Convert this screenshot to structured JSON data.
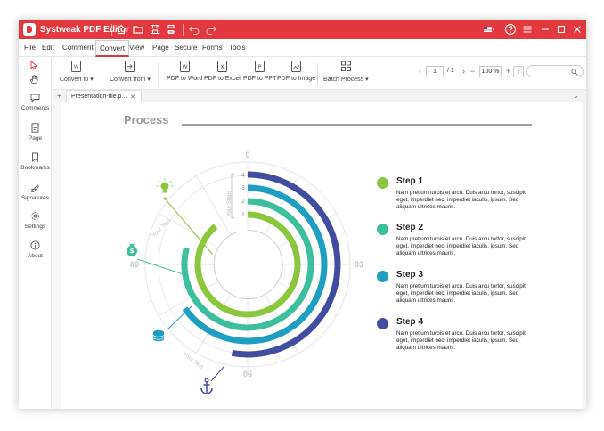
{
  "titlebar": {
    "app_title": "Systweak PDF Editor",
    "color": "#e3393e"
  },
  "menu": {
    "items": [
      "File",
      "Edit",
      "Comment",
      "Convert",
      "View",
      "Page",
      "Secure",
      "Forms",
      "Tools"
    ],
    "active": "Convert"
  },
  "toolbar": {
    "convert_to": "Convert to",
    "convert_from": "Convert from",
    "pdf_to_word": "PDF to Word",
    "pdf_to_excel": "PDF to Excel",
    "pdf_to_ppt": "PDF to PPT",
    "pdf_to_image": "PDF to Image",
    "batch_process": "Batch Process",
    "page_current": "1",
    "page_total": "/ 1",
    "zoom": "100 %"
  },
  "sidebar": {
    "items": [
      {
        "label": "Comments",
        "icon": "comment-icon"
      },
      {
        "label": "Page",
        "icon": "page-icon"
      },
      {
        "label": "Bookmarks",
        "icon": "bookmark-icon"
      },
      {
        "label": "Signatures",
        "icon": "signature-icon"
      },
      {
        "label": "Settings",
        "icon": "gear-icon"
      },
      {
        "label": "About",
        "icon": "info-icon"
      }
    ]
  },
  "tabs": {
    "document": "Presentation-file.p..."
  },
  "document": {
    "heading": "Process",
    "dial_labels": {
      "top": "0",
      "right": "03",
      "bottom": "06",
      "left": "09"
    },
    "ring_numbers": [
      "4",
      "3",
      "2",
      "1"
    ],
    "rotated_texts": {
      "steps": "Your Steps",
      "text1": "Your Text",
      "text2": "Your Text"
    },
    "colors": {
      "step1": "#8cc63f",
      "step2": "#3bbf9c",
      "step3": "#1e9ec0",
      "step4": "#434da0"
    },
    "steps": [
      {
        "title": "Step 1",
        "text": "Nam pretium turpis et arcu. Duis arcu tortor, suscipit eget, imperdiet nec, imperdiet iaculis, ipsum. Sed aliquam ultrices mauris.",
        "color": "#8cc63f"
      },
      {
        "title": "Step 2",
        "text": "Nam pretium turpis et arcu. Duis arcu tortor, suscipit eget, imperdiet nec, imperdiet iaculis, ipsum. Sed aliquam ultrices mauris.",
        "color": "#3bbf9c"
      },
      {
        "title": "Step 3",
        "text": "Nam pretium turpis et arcu. Duis arcu tortor, suscipit eget, imperdiet nec, imperdiet iaculis, ipsum. Sed aliquam ultrices mauris.",
        "color": "#1e9ec0"
      },
      {
        "title": "Step 4",
        "text": "Nam pretium turpis et arcu. Duis arcu tortor, suscipit eget, imperdiet nec, imperdiet iaculis, ipsum. Sed aliquam ultrices mauris.",
        "color": "#434da0"
      }
    ]
  }
}
